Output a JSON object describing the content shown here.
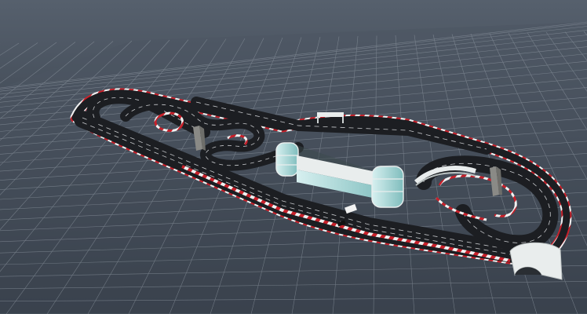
{
  "viewport": {
    "kind": "3d-perspective-viewport",
    "background_top": "#56606d",
    "background_bottom": "#232a33",
    "grid_color": "#9aa3ad",
    "ground_color": "#4d5562"
  },
  "colors": {
    "asphalt": "#1c1e22",
    "lane_line": "#c7c9cc",
    "kerb_red": "#c8202a",
    "kerb_white": "#f2f2f2",
    "grandstand_glass": "#bfe6e6",
    "grandstand_frame": "#e9eded",
    "pylon": "#8a8a86"
  },
  "scene_objects": [
    {
      "name": "main-straight",
      "type": "track"
    },
    {
      "name": "hairpin-left",
      "type": "track"
    },
    {
      "name": "chicane-infield",
      "type": "track"
    },
    {
      "name": "banked-oval-right",
      "type": "track"
    },
    {
      "name": "grandstand",
      "type": "building"
    },
    {
      "name": "footbridge",
      "type": "bridge"
    },
    {
      "name": "position-tower-left",
      "type": "pylon"
    },
    {
      "name": "position-tower-right",
      "type": "pylon"
    },
    {
      "name": "overhead-gantry",
      "type": "gantry"
    },
    {
      "name": "tunnel-bridge",
      "type": "bridge"
    },
    {
      "name": "start-finish-marker",
      "type": "marker"
    }
  ]
}
